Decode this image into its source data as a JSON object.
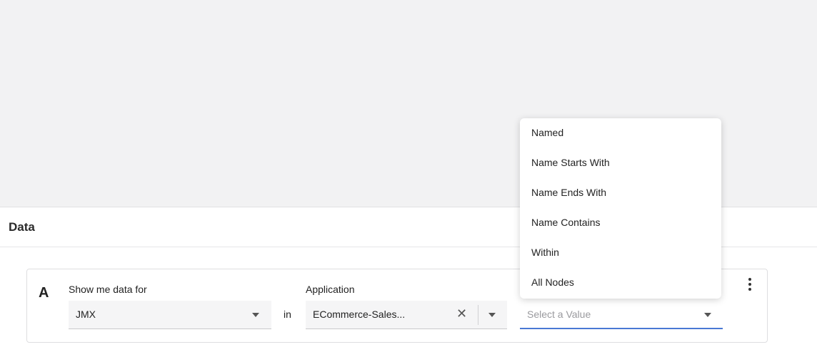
{
  "data_panel": {
    "title": "Data"
  },
  "query": {
    "letter": "A",
    "show_label": "Show me data for",
    "show_value": "JMX",
    "in_text": "in",
    "application_label": "Application",
    "application_value": "ECommerce-Sales...",
    "clear_symbol": "✕",
    "filter_placeholder": "Select a Value"
  },
  "dropdown": {
    "items": [
      {
        "label": "Named"
      },
      {
        "label": "Name Starts With"
      },
      {
        "label": "Name Ends With"
      },
      {
        "label": "Name Contains"
      },
      {
        "label": "Within"
      },
      {
        "label": "All Nodes"
      }
    ]
  },
  "colors": {
    "accent": "#4a78d4",
    "background": "#f2f2f3"
  }
}
